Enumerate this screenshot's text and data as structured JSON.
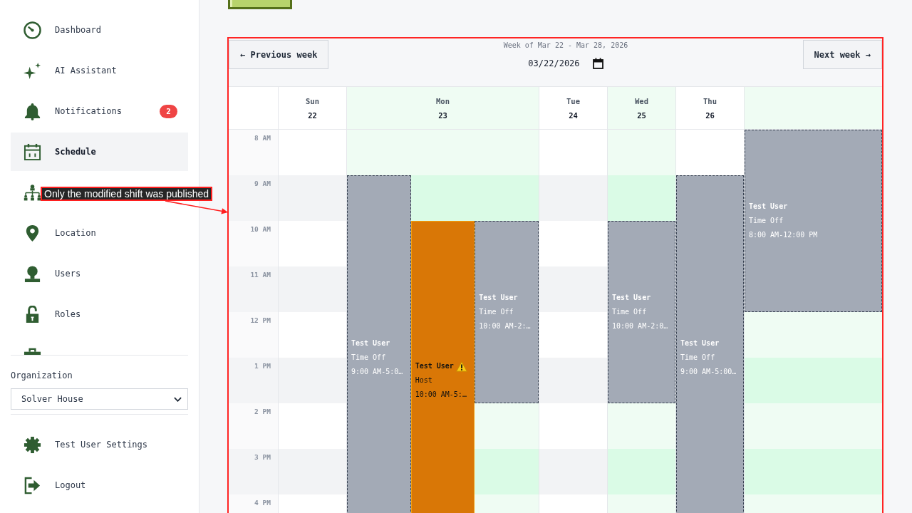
{
  "sidebar": {
    "items": [
      {
        "label": "Dashboard",
        "selected": false
      },
      {
        "label": "AI Assistant",
        "selected": false
      },
      {
        "label": "Notifications",
        "badge": "2",
        "selected": false
      },
      {
        "label": "Schedule",
        "selected": true
      },
      {
        "selected": false
      },
      {
        "label": "Location",
        "selected": false
      },
      {
        "label": "Users",
        "selected": false
      },
      {
        "label": "Roles",
        "selected": false
      },
      {
        "selected": false
      }
    ],
    "organization": {
      "label": "Organization",
      "value": "Solver House"
    },
    "account_items": [
      {
        "label": "Test User Settings",
        "selected": false
      },
      {
        "label": "Logout",
        "selected": false
      }
    ]
  },
  "calendar": {
    "previous_button": "← Previous week",
    "week_label": "Week of Mar 22 - Mar 28, 2026",
    "date": "03/22/2026",
    "next_button": "Next week →",
    "hours": [
      "8 AM",
      "9 AM",
      "10 AM",
      "11 AM",
      "12 PM",
      "1 PM",
      "2 PM",
      "3 PM",
      "4 PM"
    ],
    "days": [
      {
        "name": "Sun",
        "date": "22",
        "highlighted": false
      },
      {
        "name": "Mon",
        "date": "23",
        "highlighted": true,
        "lanes": [
          [
            {
              "kind": "free"
            },
            {
              "kind": "time_off",
              "title": "Test User",
              "subtitle": "Time Off",
              "time": "9:00 AM-5:0…",
              "warning": false
            },
            {
              "kind": "continued"
            },
            {
              "kind": "continued"
            },
            {
              "kind": "continued"
            },
            {
              "kind": "continued"
            },
            {
              "kind": "continued"
            },
            {
              "kind": "continued"
            },
            {
              "kind": "continued"
            }
          ],
          [
            {
              "kind": "free"
            },
            {
              "kind": "free"
            },
            {
              "kind": "shift",
              "title": "Test User",
              "subtitle": "Host",
              "time": "10:00 AM-5:…",
              "warning": true
            },
            {
              "kind": "continued"
            },
            {
              "kind": "continued"
            },
            {
              "kind": "continued"
            },
            {
              "kind": "continued"
            },
            {
              "kind": "continued"
            },
            {
              "kind": "continued"
            }
          ],
          [
            {
              "kind": "free"
            },
            {
              "kind": "free"
            },
            {
              "kind": "time_off",
              "title": "Test User",
              "subtitle": "Time Off",
              "time": "10:00 AM-2:…",
              "warning": false
            },
            {
              "kind": "continued"
            },
            {
              "kind": "continued"
            },
            {
              "kind": "continued"
            }
          ]
        ]
      },
      {
        "name": "Tue",
        "date": "24",
        "highlighted": false
      },
      {
        "name": "Wed",
        "date": "25",
        "highlighted": true,
        "lanes": [
          [
            {
              "kind": "free"
            },
            {
              "kind": "free"
            },
            {
              "kind": "time_off",
              "title": "Test User",
              "subtitle": "Time Off",
              "time": "10:00 AM-2:0…",
              "warning": false
            },
            {
              "kind": "continued"
            },
            {
              "kind": "continued"
            },
            {
              "kind": "continued"
            }
          ]
        ]
      },
      {
        "name": "Thu",
        "date": "26",
        "highlighted": false,
        "lanes": [
          [
            {
              "kind": "free"
            },
            {
              "kind": "time_off",
              "title": "Test User",
              "subtitle": "Time Off",
              "time": "9:00 AM-5:00…",
              "warning": false
            },
            {
              "kind": "continued"
            },
            {
              "kind": "continued"
            },
            {
              "kind": "continued"
            },
            {
              "kind": "continued"
            },
            {
              "kind": "continued"
            },
            {
              "kind": "continued"
            },
            {
              "kind": "continued"
            }
          ]
        ]
      },
      {
        "highlighted": true,
        "lanes": [
          [
            {
              "kind": "time_off",
              "title": "Test User",
              "subtitle": "Time Off",
              "time": "8:00 AM-12:00 PM",
              "warning": false
            },
            {
              "kind": "continued"
            },
            {
              "kind": "continued"
            },
            {
              "kind": "continued"
            }
          ]
        ]
      }
    ]
  },
  "annotation": {
    "text": "Only the modified shift was published",
    "outline": true
  }
}
